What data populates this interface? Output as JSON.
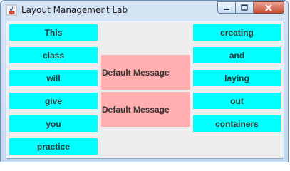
{
  "window": {
    "title": "Layout Management Lab",
    "app_icon": "java-coffee-cup-icon",
    "controls": [
      "minimize-icon",
      "maximize-icon",
      "close-icon"
    ]
  },
  "left_panel": [
    "This",
    "class",
    "will",
    "give",
    "you",
    "practice"
  ],
  "center_panel": [
    "Default Message",
    "Default Message"
  ],
  "right_panel": [
    "creating",
    "and",
    "laying",
    "out",
    "containers"
  ],
  "colors": {
    "cyan_label": "#00ffff",
    "pink_label": "#ffafaf",
    "panel_background": "#eeeeee"
  }
}
